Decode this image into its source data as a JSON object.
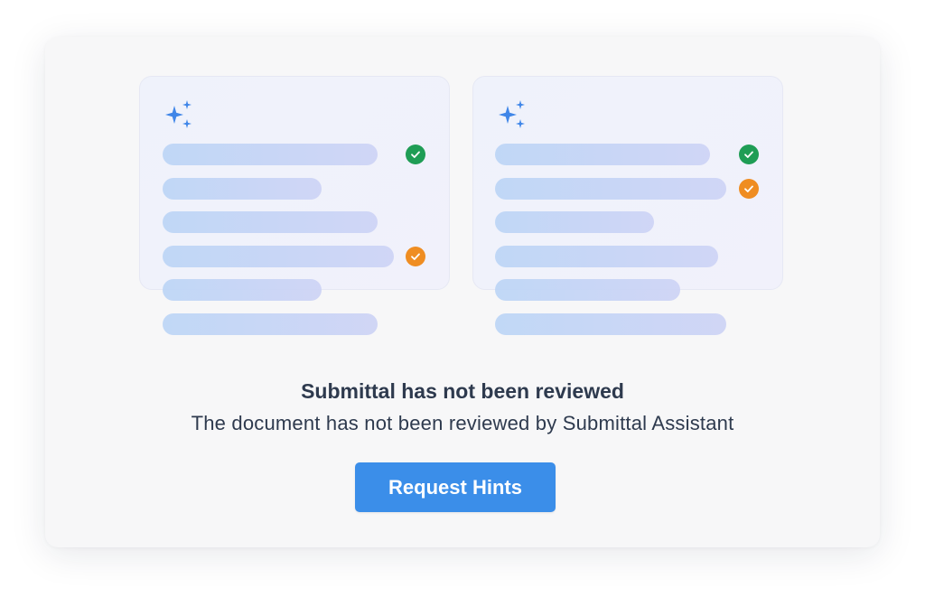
{
  "empty_state": {
    "title": "Submittal has not been reviewed",
    "message": "The document has not been reviewed by Submittal Assistant",
    "button_label": "Request Hints"
  },
  "illustration": {
    "sparkle_icon": "sparkle-icon",
    "check_icon": "check-icon",
    "colors": {
      "accent_blue": "#3b8ee9",
      "check_green": "#1f9d55",
      "check_orange": "#ef8d22",
      "sparkle_blue": "#3f86e8"
    }
  }
}
